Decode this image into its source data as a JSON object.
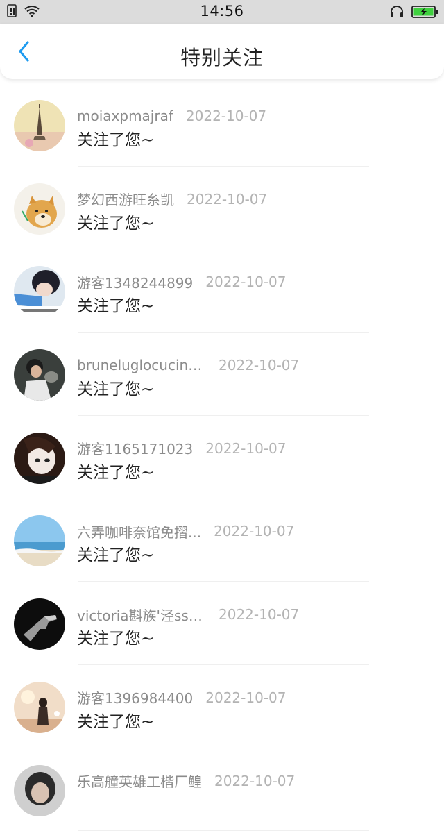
{
  "status_bar": {
    "time": "14:56",
    "icons": [
      "sim-icon",
      "wifi-icon",
      "headset-icon",
      "battery-charging-icon"
    ],
    "battery_color": "#3fd13f"
  },
  "header": {
    "title": "特别关注",
    "back_icon": "back-chevron-icon",
    "accent_color": "#1e9bf0"
  },
  "notifications": [
    {
      "name": "moiaxpmajraf",
      "date": "2022-10-07",
      "message": "关注了您~"
    },
    {
      "name": "梦幻西游旺糸凯",
      "date": "2022-10-07",
      "message": "关注了您~"
    },
    {
      "name": "游客1348244899",
      "date": "2022-10-07",
      "message": "关注了您~"
    },
    {
      "name": "bruneluglocucinelrli",
      "date": "2022-10-07",
      "message": "关注了您~"
    },
    {
      "name": "游客1165171023",
      "date": "2022-10-07",
      "message": "关注了您~"
    },
    {
      "name": "六弄咖啡奈馆免摺...",
      "date": "2022-10-07",
      "message": "关注了您~"
    },
    {
      "name": "victoria斟族'泾sse...",
      "date": "2022-10-07",
      "message": "关注了您~"
    },
    {
      "name": "游客1396984400",
      "date": "2022-10-07",
      "message": "关注了您~"
    },
    {
      "name": "乐高艟英雄工楷厂鳇",
      "date": "2022-10-07",
      "message": ""
    }
  ]
}
